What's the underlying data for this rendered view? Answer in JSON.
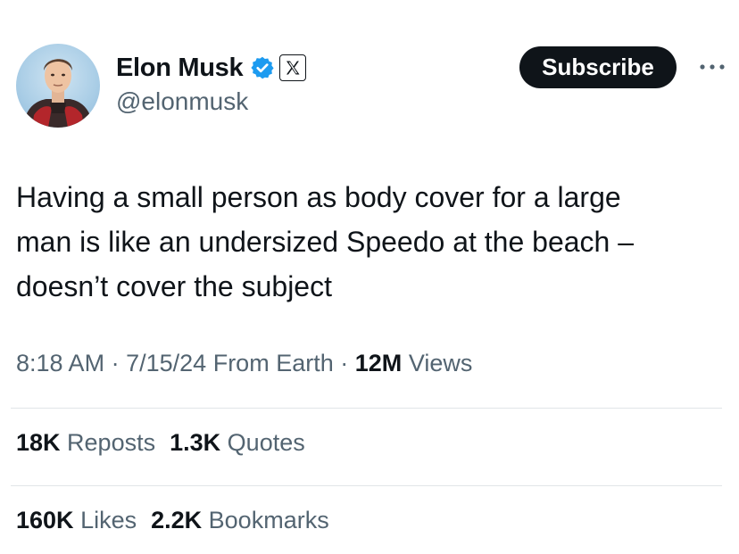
{
  "author": {
    "display_name": "Elon Musk",
    "handle": "@elonmusk",
    "avatar_icon": "profile-photo",
    "verified_icon": "verified-badge-icon",
    "verified_color": "#1d9bf0",
    "affiliate_icon": "x-logo-icon"
  },
  "actions": {
    "subscribe_label": "Subscribe",
    "more_icon": "more-options-icon"
  },
  "tweet": {
    "text_lines": [
      "Having a small person as body cover for a large",
      "man is like an undersized Speedo at the beach –",
      "doesn’t cover the subject"
    ]
  },
  "meta": {
    "time": "8:18 AM",
    "separator": "·",
    "date": "7/15/24",
    "source": "From Earth",
    "views_count": "12M",
    "views_label": "Views"
  },
  "stats": {
    "reposts_count": "18K",
    "reposts_label": "Reposts",
    "quotes_count": "1.3K",
    "quotes_label": "Quotes",
    "likes_count": "160K",
    "likes_label": "Likes",
    "bookmarks_count": "2.2K",
    "bookmarks_label": "Bookmarks"
  },
  "colors": {
    "text_primary": "#0f1419",
    "text_secondary": "#536471",
    "divider": "#e1e5e8",
    "button_bg": "#0f1419"
  }
}
